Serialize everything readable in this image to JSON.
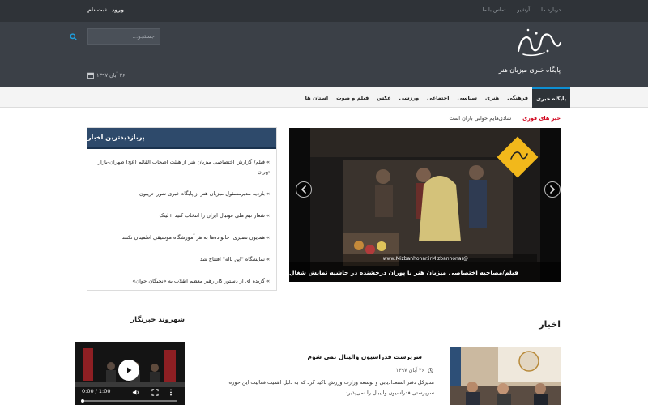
{
  "topbar": {
    "links": [
      "درباره ما",
      "آرشیو",
      "تماس با ما"
    ],
    "login": "ورود",
    "register": "ثبت نام"
  },
  "header": {
    "tagline": "پایگاه خبری میزبان هنر",
    "search": {
      "placeholder": "جستجو..."
    },
    "date": "۲۶ آبان ۱۳۹۷"
  },
  "nav": {
    "items": [
      "پایگاه خبری",
      "فرهنگی",
      "هنری",
      "سیاسی",
      "اجتماعی",
      "ورزشی",
      "عکس",
      "فیلم و صوت",
      "استان ها"
    ],
    "active_index": 0
  },
  "ticker": {
    "label": "خبر های فوری",
    "text": "شادی‌هایم خوابی باران است"
  },
  "slider": {
    "caption": "فیلم/مصاحبه اختصاصی میزبان هنر با پوران درخشنده در حاشیه نمایش شغال",
    "overlay_url": "www.Mizbanhonar.ir",
    "overlay_handle": "@Mizbanhonar"
  },
  "most_visited": {
    "title": "پربازدیدترین اخبار",
    "items": [
      "» فیلم/ گزارش اختصاصی میزبان هنر از هیئت اصحاب القائم (عج) طهران-بازار تهران",
      "» بازدید مدیرمسئول میزبان هنر از پایگاه خبری شورا تریبون",
      "» شعار تیم ملی فوتبال ایران را انتخاب کنید +لینک",
      "» همایون نصیری: خانواده‌ها به هر آموزشگاه موسیقی اطمینان نکنند",
      "» نمایشگاه \"این ناله\" افتتاح شد",
      "» گزیده ای از دستور کار رهبر معظم انقلاب به «نخبگان جوان»"
    ]
  },
  "news_section": {
    "title": "اخبار",
    "item": {
      "title": "سرپرست فدراسیون والیبال نمی شوم",
      "date": "۲۶ آبان ۱۳۹۷",
      "excerpt": "مدیرکل دفتر استعدادیابی و توسعه وزارت ورزش تاکید کرد که به دلیل اهمیت فعالیت این حوزه، سرپرستی فدراسیون والیبال را نمی‌پذیرد."
    }
  },
  "citizen_section": {
    "title": "شهروند خبرنگار",
    "video": {
      "time": "0:00 / 1:00",
      "progress": 0
    }
  },
  "colors": {
    "topbar": "#2f3338",
    "header": "#3b4047",
    "accent_blue": "#0d8fd3",
    "breaking_red": "#d0021b",
    "panel_head": "#2e4a6b"
  }
}
